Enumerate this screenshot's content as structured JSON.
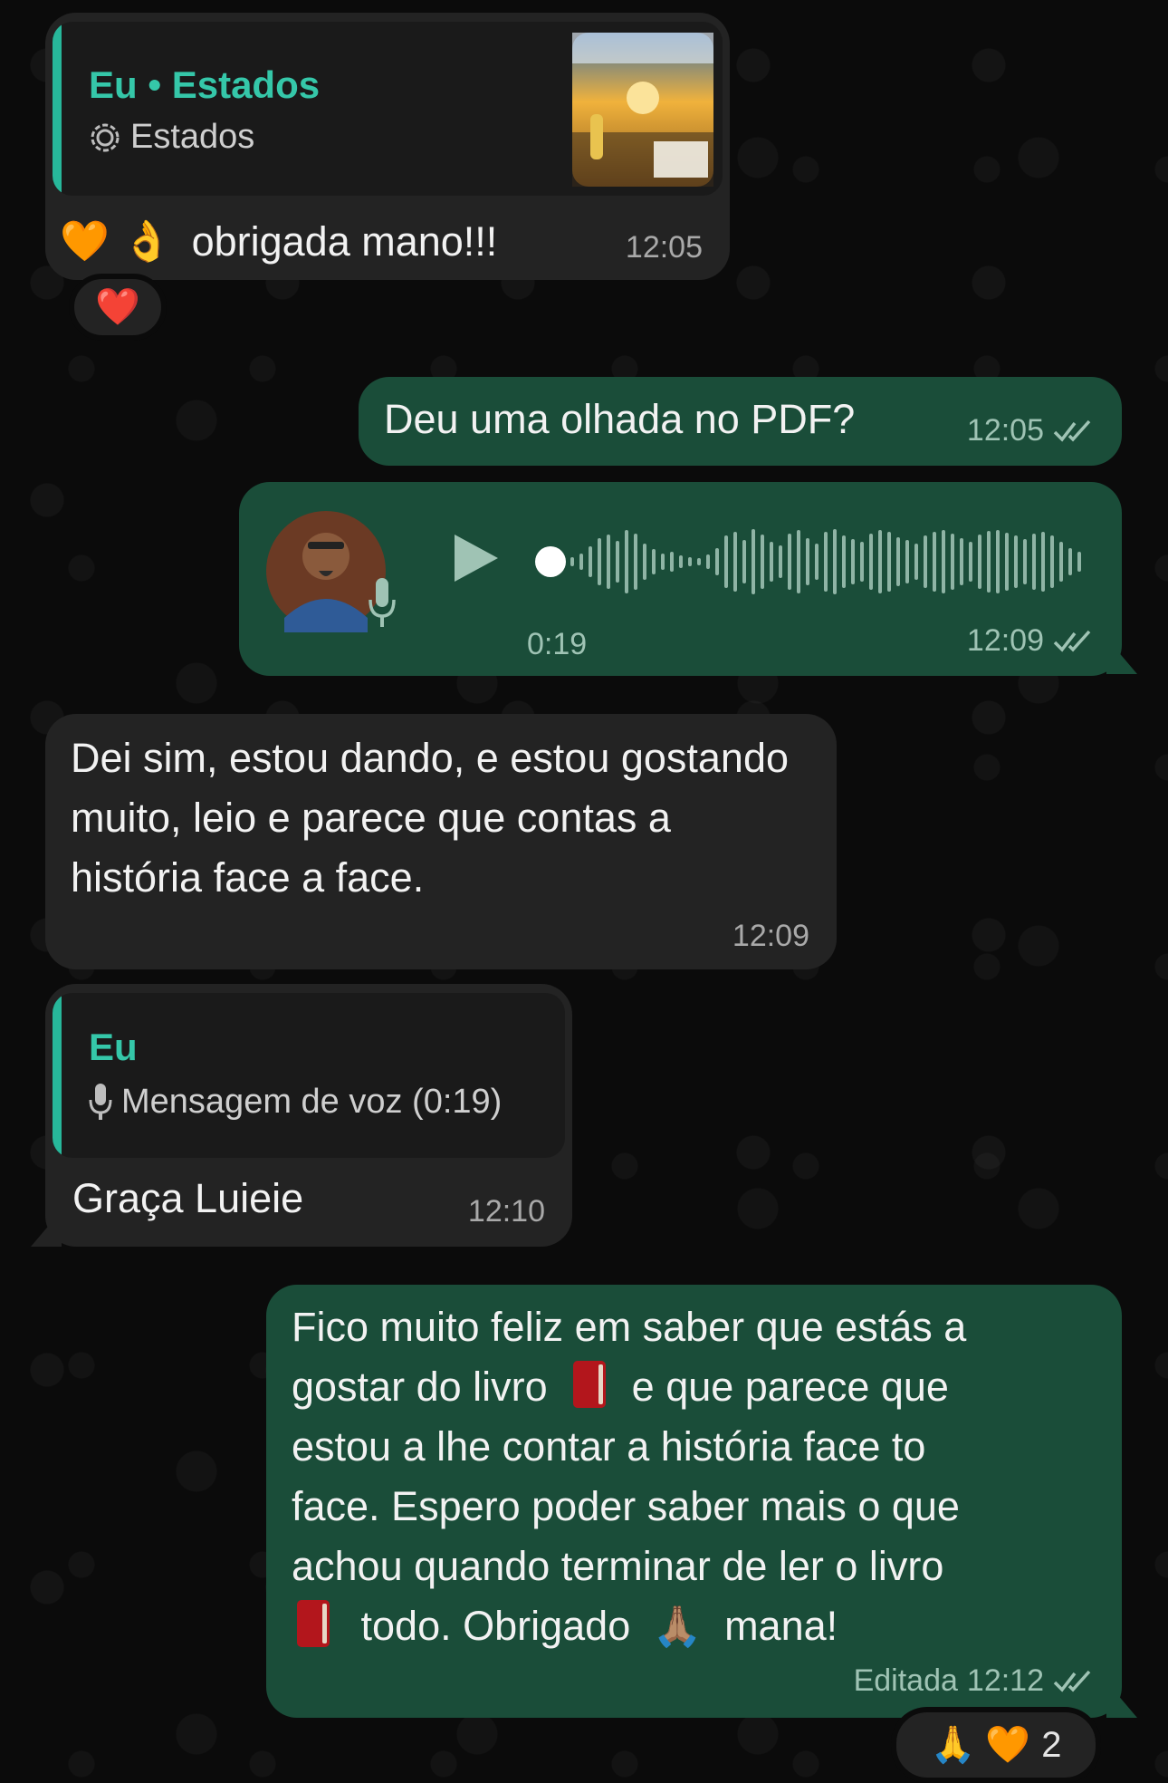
{
  "colors": {
    "incoming": "#232323",
    "outgoing": "#1a4d39",
    "accent": "#35c7a9",
    "background": "#0b0b0b"
  },
  "msg1": {
    "quote_title": "Eu • Estados",
    "quote_sub": "Estados",
    "quote_icon": "status-icon",
    "emoji_heart": "🧡",
    "emoji_ok": "👌",
    "text": "obrigada mano!!!",
    "time": "12:05",
    "reaction": "❤️"
  },
  "msg2": {
    "text": "Deu uma olhada no PDF?",
    "time": "12:05"
  },
  "msg3": {
    "duration": "0:19",
    "time": "12:09",
    "mic_icon": "microphone-icon"
  },
  "msg4": {
    "text": "Dei sim, estou dando, e estou gostando muito, leio e parece que contas a história face a face.",
    "time": "12:09"
  },
  "msg5": {
    "quote_title": "Eu",
    "quote_sub": "Mensagem de voz (0:19)",
    "text": "Graça Luieie",
    "time": "12:10"
  },
  "msg6": {
    "line1": "Fico muito feliz em saber que estás a",
    "line2a": "gostar do livro",
    "line2b": "e que parece que",
    "line3": "estou a lhe contar a história face to",
    "line4": "face. Espero poder saber mais o que",
    "line5": "achou quando terminar de ler o livro",
    "line6a": "todo. Obrigado",
    "line6_emoji": "🙏🏽",
    "line6b": "mana!",
    "edited": "Editada",
    "time": "12:12",
    "reaction_emojis": "🙏 🧡",
    "reaction_count": "2"
  }
}
